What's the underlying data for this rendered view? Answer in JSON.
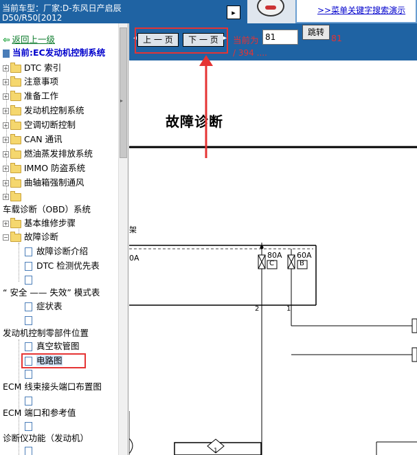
{
  "header": {
    "car_label_line1": "当前车型：厂家:D-东风日产启辰",
    "car_label_line2": "D50/R50[2012",
    "toggle_glyph": "▸",
    "search_demo_link": ">>菜单关键字搜索演示"
  },
  "nav": {
    "prev_button": "上 一 页",
    "next_button": "下 一 页",
    "current_label": "当前为",
    "page_value": "81",
    "jump_button": "跳转",
    "current_number": "81",
    "total_text": "/ 394 ...."
  },
  "document": {
    "title": "故障诊断",
    "frame_label": "架",
    "fuse_labels": [
      "80A",
      "60A"
    ],
    "fuse_letters": [
      "C",
      "B"
    ],
    "terminal_numbers": [
      "2",
      "1"
    ],
    "frag_label": "0A",
    "connector_number": "1"
  },
  "tree": {
    "back": "返回上一级",
    "current": "当前:EC发动机控制系统",
    "items": [
      "DTC 索引",
      "注意事项",
      "准备工作",
      "发动机控制系统",
      "空调切断控制",
      "CAN 通讯",
      "燃油蒸发排放系统",
      "IMMO 防盗系统",
      "曲轴箱强制通风"
    ],
    "obd_label": "车载诊断（OBD）系统",
    "basic_inspection": "基本维修步骤",
    "trouble_diag": "故障诊断",
    "sub_items": [
      "故障诊断介绍",
      "DTC 检测优先表"
    ],
    "fail_safe": "“ 安全 —— 失效” 模式表",
    "symptom": "症状表",
    "component_location": "发动机控制零部件位置",
    "vacuum": "真空软管图",
    "wiring": "电路图",
    "harness": "ECM 线束接头端口布置图",
    "terminal": "ECM 端口和参考值",
    "consult": "诊断仪功能（发动机）"
  },
  "colors": {
    "header_blue": "#1f63a3",
    "annotation_red": "#e53333",
    "link_blue": "#0000cc",
    "back_green": "#0a7a2a"
  }
}
